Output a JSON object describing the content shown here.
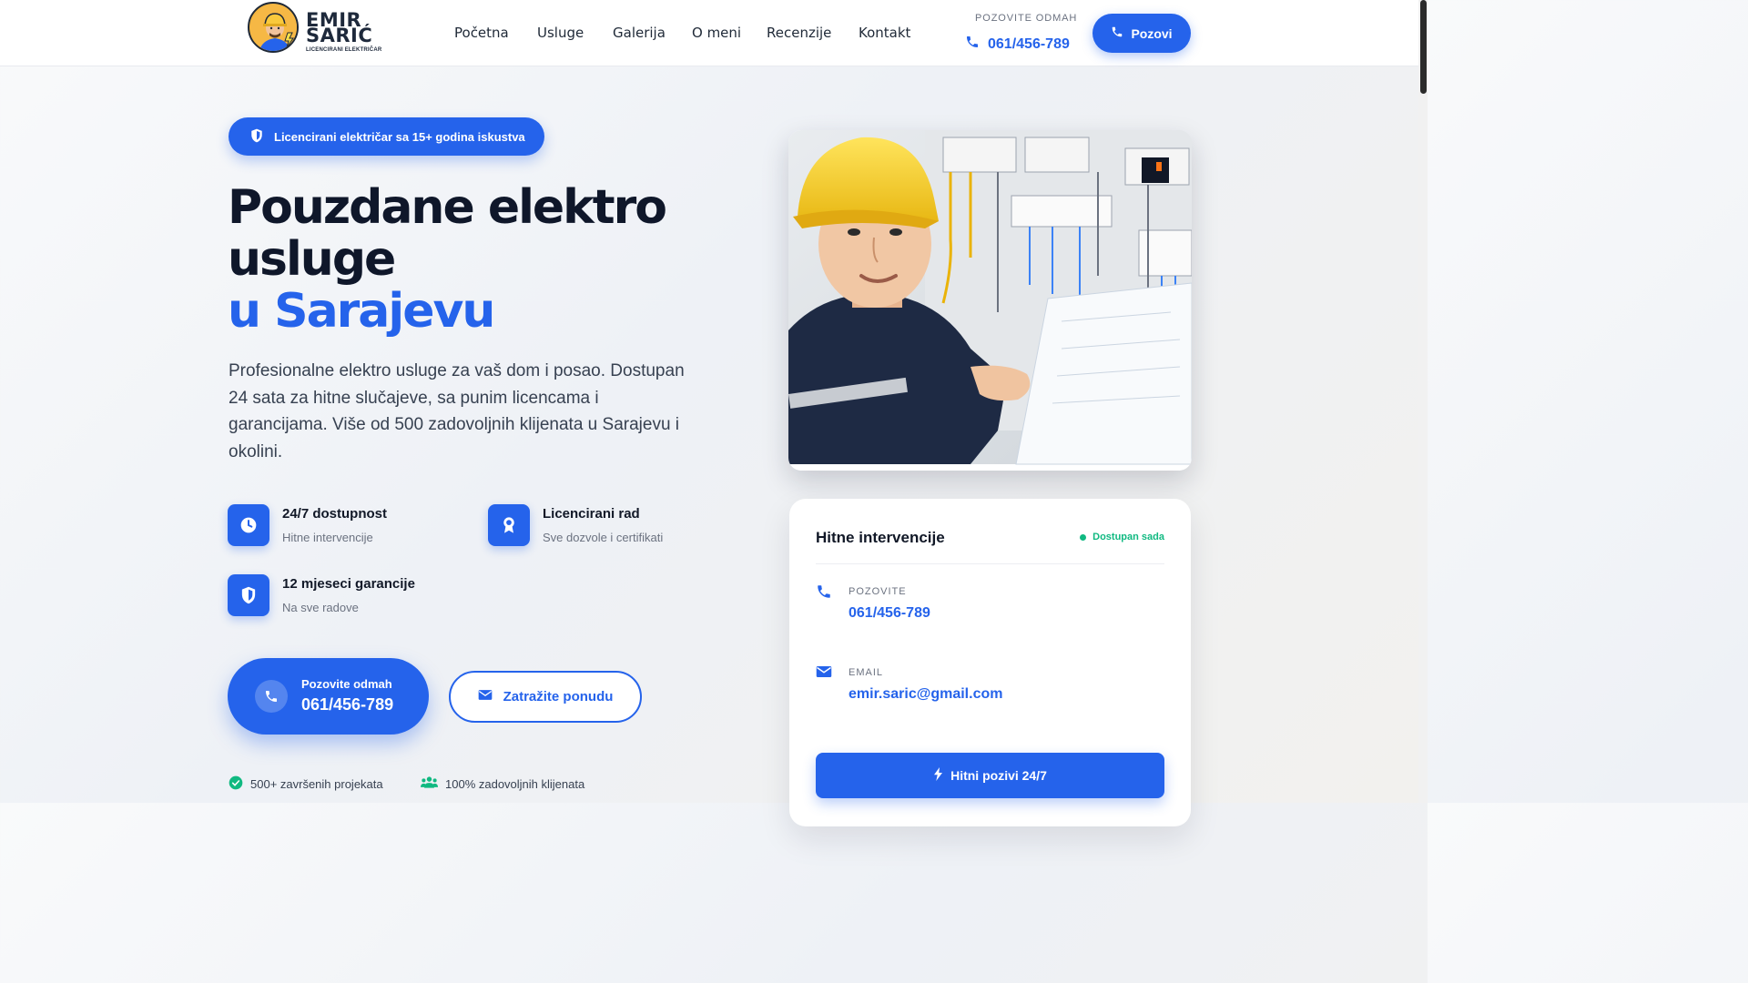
{
  "header": {
    "logo": {
      "line1": "EMIR",
      "line2": "SARIĆ",
      "sub": "LICENCIRANI ELEKTRIČAR"
    },
    "nav": [
      "Početna",
      "Usluge",
      "Galerija",
      "O meni",
      "Recenzije",
      "Kontakt"
    ],
    "call_label": "POZOVITE ODMAH",
    "phone": "061/456-789",
    "call_button": "Pozovi"
  },
  "hero": {
    "badge": "Licencirani električar sa 15+ godina iskustva",
    "title_line1": "Pouzdane elektro",
    "title_line2": "usluge",
    "title_accent": "u Sarajevu",
    "lead": "Profesionalne elektro usluge za vaš dom i posao. Dostupan 24 sata za hitne slučajeve, sa punim licencama i garancijama. Više od 500 zadovoljnih klijenata u Sarajevu i okolini.",
    "features": [
      {
        "title": "24/7 dostupnost",
        "sub": "Hitne intervencije",
        "icon": "clock-icon"
      },
      {
        "title": "Licencirani rad",
        "sub": "Sve dozvole i certifikati",
        "icon": "award-icon"
      },
      {
        "title": "12 mjeseci garancije",
        "sub": "Na sve radove",
        "icon": "shield-icon"
      }
    ],
    "primary_cta": {
      "label": "Pozovite odmah",
      "phone": "061/456-789"
    },
    "secondary_cta": "Zatražite ponudu",
    "stats": [
      "500+ završenih projekata",
      "100% zadovoljnih klijenata"
    ]
  },
  "info_card": {
    "title": "Hitne intervencije",
    "status": "Dostupan sada",
    "phone_label": "POZOVITE",
    "phone": "061/456-789",
    "email_label": "EMAIL",
    "email": "emir.saric@gmail.com",
    "urgent_button": "Hitni pozivi 24/7"
  },
  "colors": {
    "accent": "#2563eb",
    "status": "#10b981",
    "heading": "#0f172a"
  }
}
